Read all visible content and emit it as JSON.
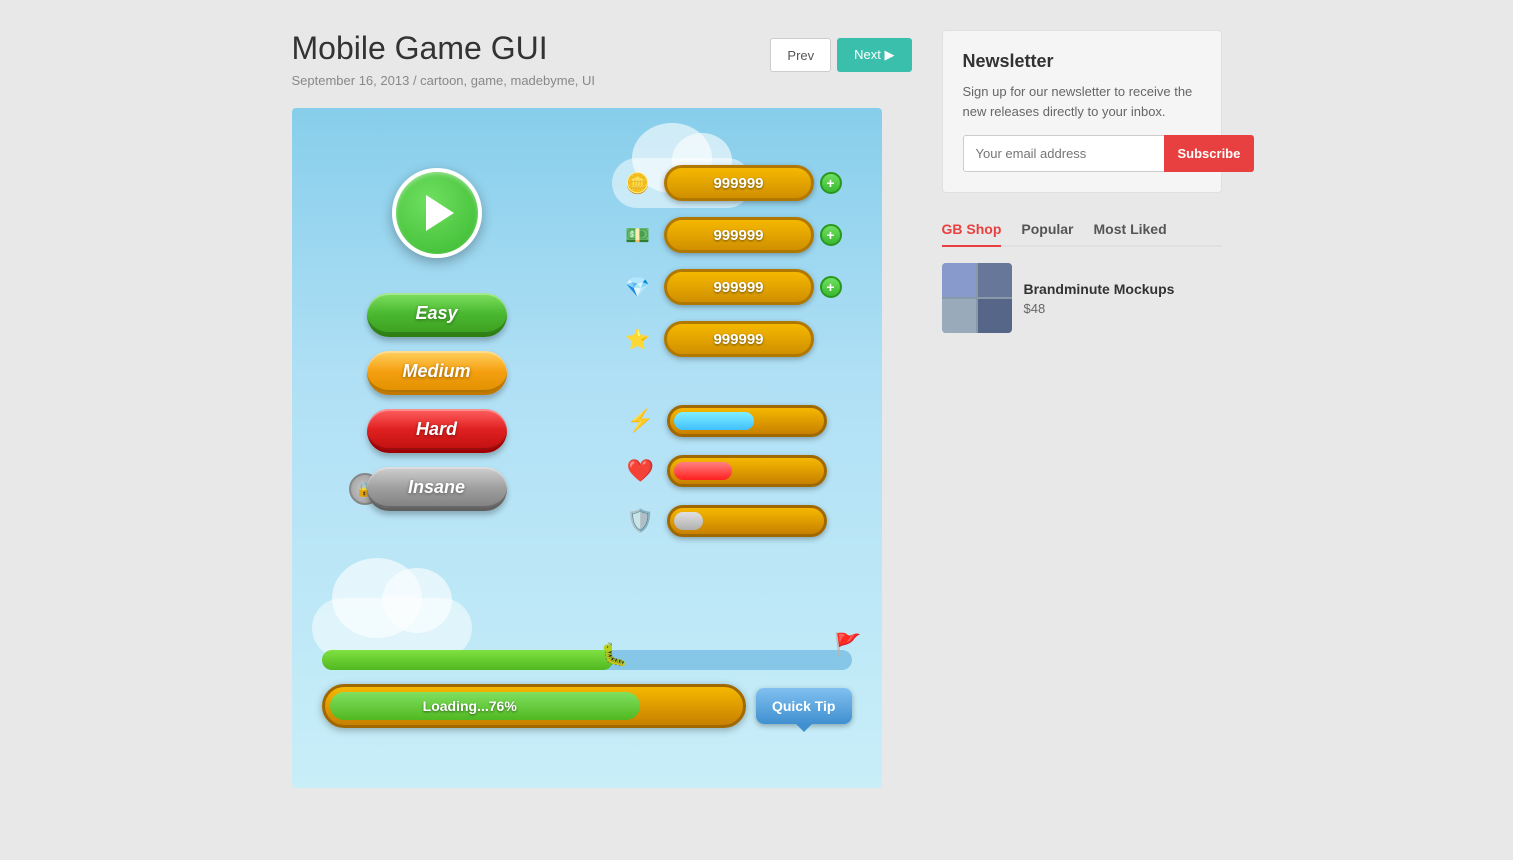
{
  "page": {
    "title": "Mobile Game GUI",
    "date": "September 16, 2013",
    "tags": "cartoon, game, madebyme, UI",
    "prev_label": "Prev",
    "next_label": "Next"
  },
  "game": {
    "difficulty_buttons": [
      {
        "label": "Easy",
        "class": "btn-easy"
      },
      {
        "label": "Medium",
        "class": "btn-medium"
      },
      {
        "label": "Hard",
        "class": "btn-hard"
      },
      {
        "label": "Insane",
        "class": "btn-insane"
      }
    ],
    "resources": [
      {
        "icon": "🪙",
        "value": "999999",
        "has_plus": true
      },
      {
        "icon": "💵",
        "value": "999999",
        "has_plus": true
      },
      {
        "icon": "💎",
        "value": "999999",
        "has_plus": true
      },
      {
        "icon": "⭐",
        "value": "999999",
        "has_plus": false
      }
    ],
    "stat_bars": [
      {
        "icon": "⚡",
        "fill_class": "bar-blue",
        "width": "55%"
      },
      {
        "icon": "❤️",
        "fill_class": "bar-red",
        "width": "40%"
      },
      {
        "icon": "🛡️",
        "fill_class": "bar-gray",
        "width": "20%"
      }
    ],
    "loading_text": "Loading...76%",
    "quick_tip_label": "Quick Tip",
    "worm_progress": "55%",
    "loading_progress": "76%"
  },
  "newsletter": {
    "title": "Newsletter",
    "description": "Sign up for our newsletter to receive the new releases directly to your inbox.",
    "email_placeholder": "Your email address",
    "subscribe_label": "Subscribe"
  },
  "sidebar_tabs": [
    {
      "label": "GB Shop",
      "active": true
    },
    {
      "label": "Popular",
      "active": false
    },
    {
      "label": "Most Liked",
      "active": false
    }
  ],
  "products": [
    {
      "name": "Brandminute Mockups",
      "price": "$48"
    }
  ]
}
